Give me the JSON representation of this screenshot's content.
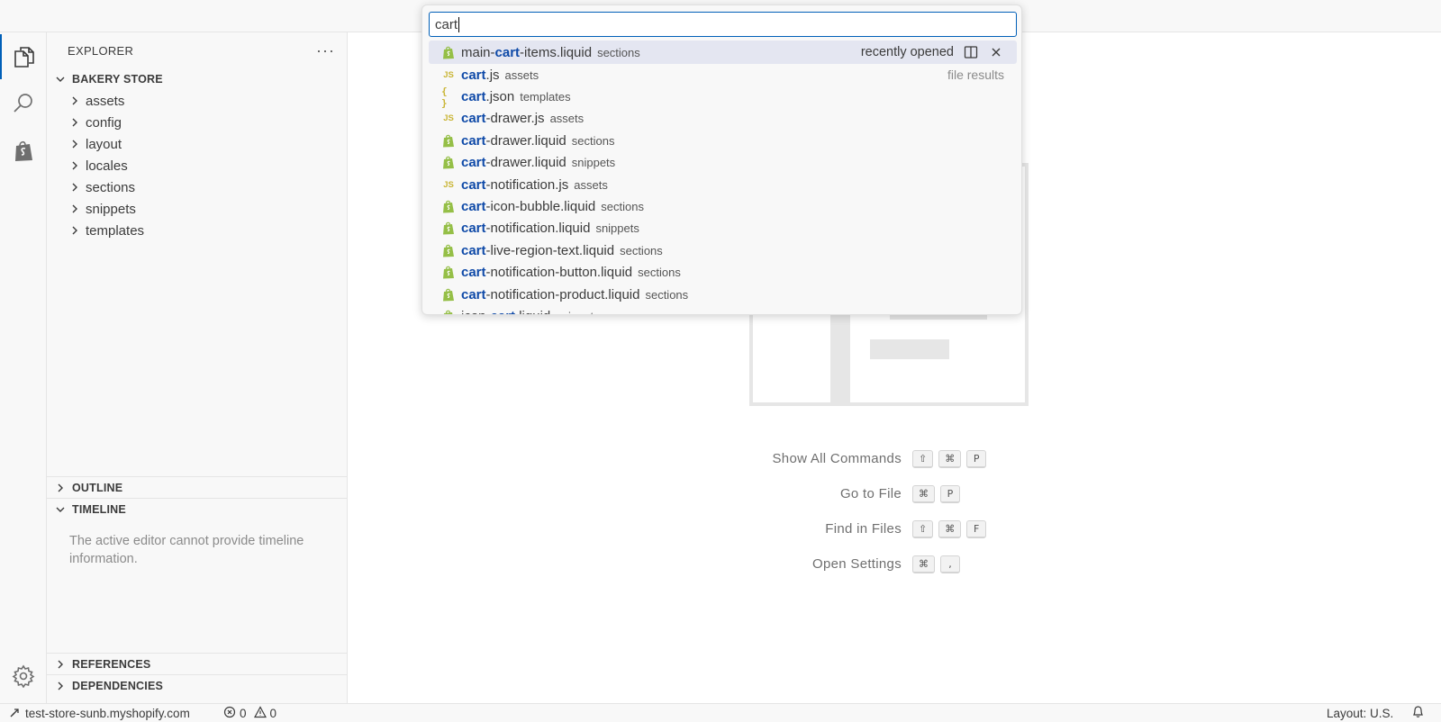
{
  "sidebar": {
    "title": "EXPLORER",
    "more_label": "···",
    "workspace": "BAKERY STORE",
    "folders": [
      "assets",
      "config",
      "layout",
      "locales",
      "sections",
      "snippets",
      "templates"
    ],
    "outline": "OUTLINE",
    "timeline": "TIMELINE",
    "timeline_message": "The active editor cannot provide timeline information.",
    "references": "REFERENCES",
    "dependencies": "DEPENDENCIES"
  },
  "quick_open": {
    "query": "cart",
    "recently_opened_label": "recently opened",
    "file_results_label": "file results",
    "items": [
      {
        "icon": "shopify",
        "pre": "main-",
        "match": "cart",
        "post": "-items.liquid",
        "dir": "sections"
      },
      {
        "icon": "js",
        "pre": "",
        "match": "cart",
        "post": ".js",
        "dir": "assets"
      },
      {
        "icon": "json",
        "pre": "",
        "match": "cart",
        "post": ".json",
        "dir": "templates"
      },
      {
        "icon": "js",
        "pre": "",
        "match": "cart",
        "post": "-drawer.js",
        "dir": "assets"
      },
      {
        "icon": "shopify",
        "pre": "",
        "match": "cart",
        "post": "-drawer.liquid",
        "dir": "sections"
      },
      {
        "icon": "shopify",
        "pre": "",
        "match": "cart",
        "post": "-drawer.liquid",
        "dir": "snippets"
      },
      {
        "icon": "js",
        "pre": "",
        "match": "cart",
        "post": "-notification.js",
        "dir": "assets"
      },
      {
        "icon": "shopify",
        "pre": "",
        "match": "cart",
        "post": "-icon-bubble.liquid",
        "dir": "sections"
      },
      {
        "icon": "shopify",
        "pre": "",
        "match": "cart",
        "post": "-notification.liquid",
        "dir": "snippets"
      },
      {
        "icon": "shopify",
        "pre": "",
        "match": "cart",
        "post": "-live-region-text.liquid",
        "dir": "sections"
      },
      {
        "icon": "shopify",
        "pre": "",
        "match": "cart",
        "post": "-notification-button.liquid",
        "dir": "sections"
      },
      {
        "icon": "shopify",
        "pre": "",
        "match": "cart",
        "post": "-notification-product.liquid",
        "dir": "sections"
      },
      {
        "icon": "shopify",
        "pre": "icon-",
        "match": "cart",
        "post": ".liquid",
        "dir": "snippets"
      }
    ]
  },
  "shortcuts": [
    {
      "label": "Show All Commands",
      "keys": [
        "⇧",
        "⌘",
        "P"
      ]
    },
    {
      "label": "Go to File",
      "keys": [
        "⌘",
        "P"
      ]
    },
    {
      "label": "Find in Files",
      "keys": [
        "⇧",
        "⌘",
        "F"
      ]
    },
    {
      "label": "Open Settings",
      "keys": [
        "⌘",
        ","
      ]
    }
  ],
  "status": {
    "remote": "test-store-sunb.myshopify.com",
    "errors": "0",
    "warnings": "0",
    "layout": "Layout: U.S."
  },
  "colors": {
    "accent": "#005fb8",
    "match_highlight": "#0f4aa8",
    "shopify_green": "#95bf47",
    "js_yellow": "#c9b535"
  }
}
